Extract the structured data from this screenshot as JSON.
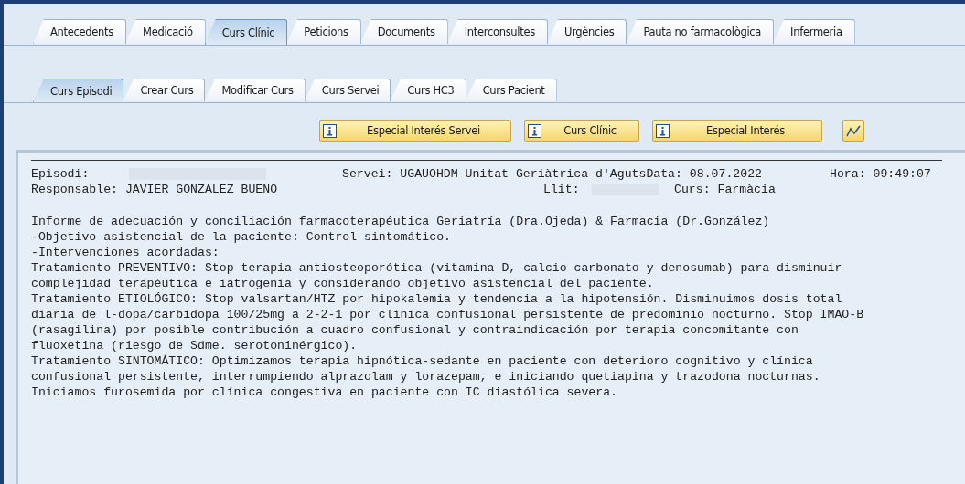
{
  "tabs": [
    {
      "label": "Antecedents",
      "selected": false
    },
    {
      "label": "Medicació",
      "selected": false
    },
    {
      "label": "Curs Clínic",
      "selected": true
    },
    {
      "label": "Peticions",
      "selected": false
    },
    {
      "label": "Documents",
      "selected": false
    },
    {
      "label": "Interconsultes",
      "selected": false
    },
    {
      "label": "Urgències",
      "selected": false
    },
    {
      "label": "Pauta no farmacològica",
      "selected": false
    },
    {
      "label": "Infermeria",
      "selected": false
    }
  ],
  "subtabs": [
    {
      "label": "Curs Episodi",
      "selected": true
    },
    {
      "label": "Crear Curs",
      "selected": false
    },
    {
      "label": "Modificar Curs",
      "selected": false
    },
    {
      "label": "Curs Servei",
      "selected": false
    },
    {
      "label": "Curs HC3",
      "selected": false
    },
    {
      "label": "Curs Pacient",
      "selected": false
    }
  ],
  "buttons": [
    {
      "label": "Especial Interés Servei"
    },
    {
      "label": "Curs Clínic"
    },
    {
      "label": "Especial Interés"
    }
  ],
  "header": {
    "episodi_label": "Episodi:",
    "servei": "Servei: UGAUOHDM Unitat Geriàtrica d'AgutsData: 08.07.2022",
    "hora": "Hora: 09:49:07",
    "responsable": "Responsable: JAVIER GONZALEZ BUENO",
    "llit_label": "Llit:",
    "curs": "Curs: Farmàcia"
  },
  "report_lines": [
    "Informe de adecuación y conciliación farmacoterapéutica Geriatría (Dra.Ojeda) & Farmacia (Dr.González)",
    "-Objetivo asistencial de la paciente: Control sintomático.",
    "-Intervenciones acordadas:",
    "Tratamiento PREVENTIVO: Stop terapia antiosteoporótica (vitamina D, calcio carbonato y denosumab) para disminuir",
    "complejidad terapéutica e iatrogenia y considerando objetivo asistencial del paciente.",
    "Tratamiento ETIOLÓGICO: Stop valsartan/HTZ por hipokalemia y tendencia a la hipotensión. Disminuimos dosis total",
    "diaria de l-dopa/carbidopa 100/25mg a 2-2-1 por clínica confusional persistente de predominio nocturno. Stop IMAO-B",
    "(rasagilina) por posible contribución a cuadro confusional y contraindicación por terapia concomitante con",
    "fluoxetina (riesgo de Sdme. serotoninérgico).",
    "Tratamiento SINTOMÁTICO: Optimizamos terapia hipnótica-sedante en paciente con deterioro cognitivo y clínica",
    "confusional persistente, interrumpiendo alprazolam y lorazepam, e iniciando quetiapina y trazodona nocturnas.",
    "Iniciamos furosemida por clínica congestiva en paciente con IC diastólica severa."
  ]
}
